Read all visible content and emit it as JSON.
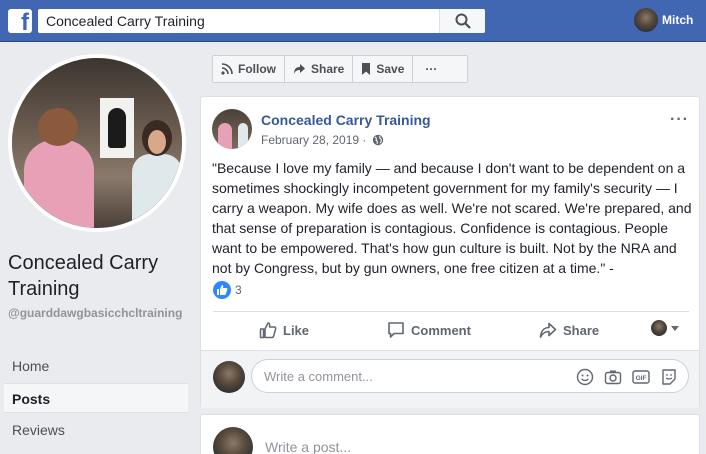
{
  "topbar": {
    "logo_letter": "f",
    "search_value": "Concealed Carry Training",
    "user_name": "Mitch"
  },
  "sidebar": {
    "page_title": "Concealed Carry Training",
    "page_handle": "@guarddawgbasicchcltraining",
    "nav": [
      {
        "label": "Home",
        "active": false
      },
      {
        "label": "Posts",
        "active": true
      },
      {
        "label": "Reviews",
        "active": false
      }
    ]
  },
  "actionbar": {
    "follow": "Follow",
    "share": "Share",
    "save": "Save",
    "more": "···"
  },
  "post": {
    "author": "Concealed Carry Training",
    "date": "February 28, 2019",
    "separator": " · ",
    "menu": "···",
    "text": "\"Because I love my family — and because I don't want to be dependent on a sometimes shockingly incompetent government for my family's security — I carry a weapon. My wife does as well. We're not scared. We're prepared, and that sense of preparation is contagious. Confidence is contagious. People want to be empowered. That's how gun culture is built. Not by the NRA and not by Congress, but by gun owners, one free citizen at a time.\" -",
    "reaction_count": "3",
    "actions": {
      "like": "Like",
      "comment": "Comment",
      "share": "Share"
    },
    "comment_placeholder": "Write a comment..."
  },
  "composer": {
    "placeholder": "Write a post..."
  },
  "colors": {
    "brand": "#4267b2",
    "link": "#365899",
    "like_blue": "#2d88ff"
  }
}
